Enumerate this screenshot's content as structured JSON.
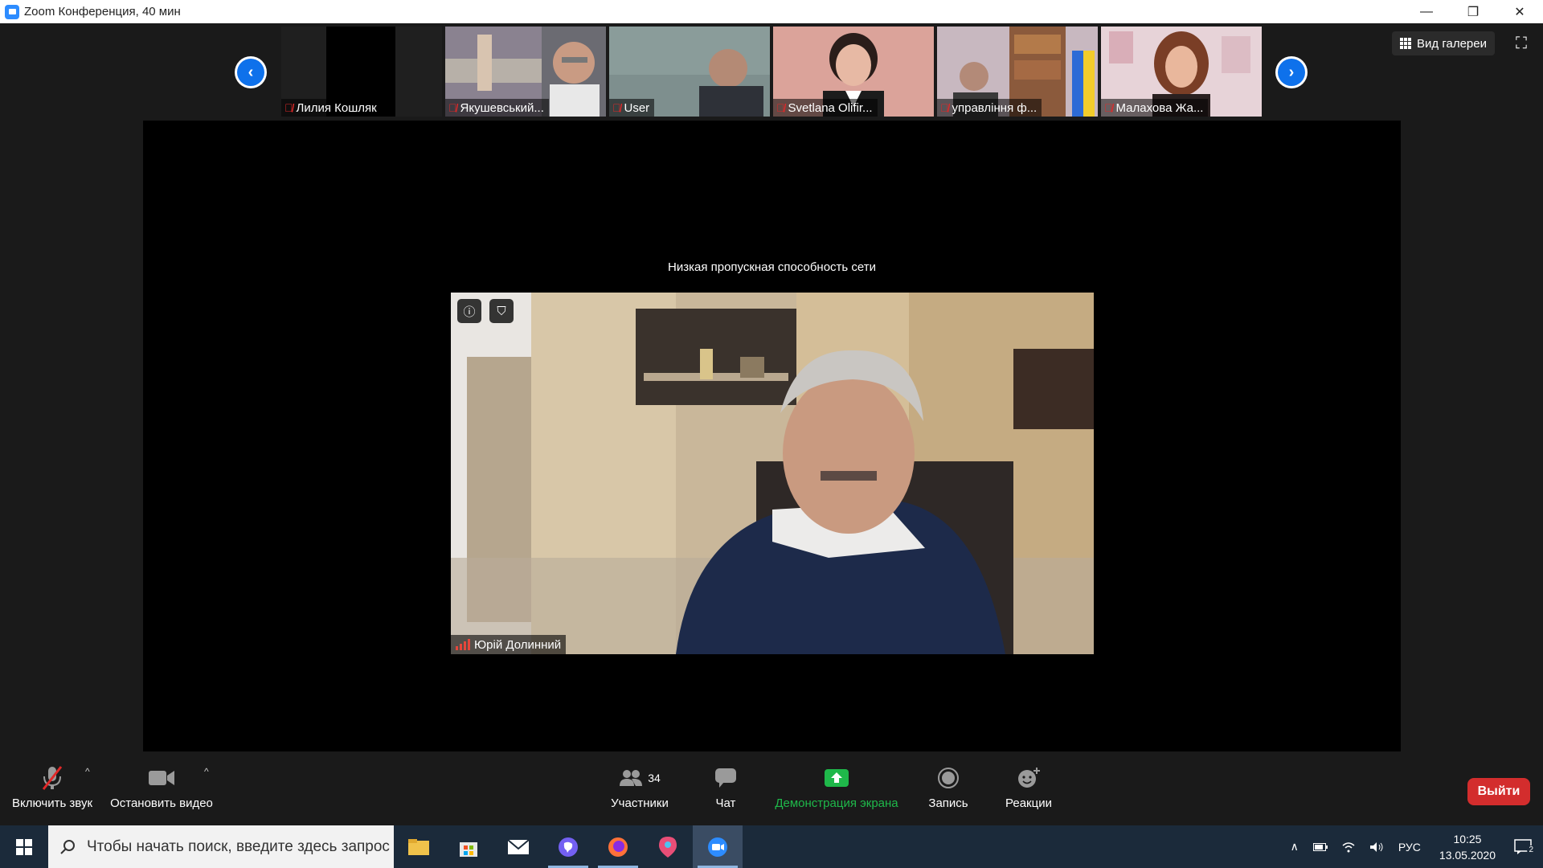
{
  "window": {
    "title": "Zoom Конференция, 40 мин"
  },
  "gallery": {
    "view_label": "Вид галереи",
    "participants": [
      {
        "name": "Лилия Кошляк",
        "muted": true
      },
      {
        "name": "Якушевський...",
        "muted": true
      },
      {
        "name": "User",
        "muted": true
      },
      {
        "name": "Svetlana Olifir...",
        "muted": true
      },
      {
        "name": "управління ф...",
        "muted": true
      },
      {
        "name": "Малахова Жа...",
        "muted": true
      }
    ]
  },
  "stage": {
    "bandwidth_message": "Низкая пропускная способность сети",
    "speaker_name": "Юрій Долинний"
  },
  "toolbar": {
    "unmute_label": "Включить звук",
    "stop_video_label": "Остановить видео",
    "participants_label": "Участники",
    "participants_count": "34",
    "chat_label": "Чат",
    "share_label": "Демонстрация экрана",
    "record_label": "Запись",
    "reactions_label": "Реакции",
    "leave_label": "Выйти"
  },
  "taskbar": {
    "search_placeholder": "Чтобы начать поиск, введите здесь запрос",
    "language": "РУС",
    "time": "10:25",
    "date": "13.05.2020",
    "notifications": "2"
  },
  "colors": {
    "accent_blue": "#0e71eb",
    "share_green": "#1fb84a",
    "leave_red": "#d32d2d",
    "muted_red": "#e02828"
  }
}
